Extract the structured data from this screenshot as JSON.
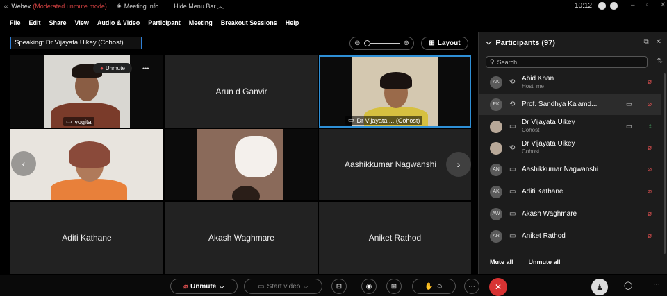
{
  "titlebar": {
    "app": "Webex",
    "mode": "(Moderated unmute mode)",
    "meeting_info": "Meeting Info",
    "hide_menu": "Hide Menu Bar ︿",
    "clock": "10:12"
  },
  "menu": [
    "File",
    "Edit",
    "Share",
    "View",
    "Audio & Video",
    "Participant",
    "Meeting",
    "Breakout Sessions",
    "Help"
  ],
  "speaking": "Speaking: Dr Vijayata Uikey (Cohost)",
  "layout_label": "Layout",
  "tiles": {
    "yogita": "yogita",
    "unmute_pill": "Unmute",
    "arun": "Arun d Ganvir",
    "vijayata": "Dr Vijayata ... (Cohost)",
    "aashik": "Aashikkumar Nagwanshi",
    "aditi": "Aditi Kathane",
    "akash": "Akash Waghmare",
    "aniket": "Aniket Rathod"
  },
  "panel": {
    "title": "Participants (97)",
    "search_placeholder": "Search",
    "mute_all": "Mute all",
    "unmute_all": "Unmute all",
    "participants": [
      {
        "initials": "AK",
        "name": "Abid Khan",
        "sub": "Host, me",
        "mic": "off",
        "cam": false
      },
      {
        "initials": "PK",
        "name": "Prof. Sandhya Kalamd...",
        "sub": "",
        "mic": "off",
        "cam": true
      },
      {
        "initials": "",
        "name": "Dr Vijayata Uikey",
        "sub": "Cohost",
        "mic": "on",
        "cam": true
      },
      {
        "initials": "",
        "name": "Dr Vijayata Uikey",
        "sub": "Cohost",
        "mic": "off",
        "cam": false
      },
      {
        "initials": "AN",
        "name": "Aashikkumar Nagwanshi",
        "sub": "",
        "mic": "off",
        "cam": false
      },
      {
        "initials": "AK",
        "name": "Aditi Kathane",
        "sub": "",
        "mic": "off",
        "cam": false
      },
      {
        "initials": "AW",
        "name": "Akash Waghmare",
        "sub": "",
        "mic": "off",
        "cam": false
      },
      {
        "initials": "AR",
        "name": "Aniket Rathod",
        "sub": "",
        "mic": "off",
        "cam": false
      }
    ]
  },
  "controls": {
    "unmute": "Unmute",
    "start_video": "Start video"
  }
}
